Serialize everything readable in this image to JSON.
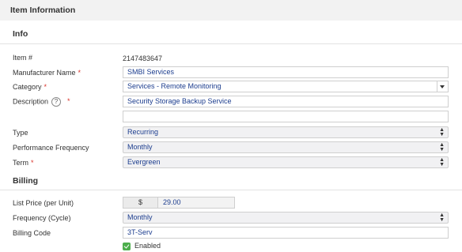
{
  "header": {
    "title": "Item Information"
  },
  "info": {
    "title": "Info",
    "item_number": {
      "label": "Item #",
      "value": "2147483647"
    },
    "manufacturer_name": {
      "label": "Manufacturer Name",
      "required_mark": "*",
      "value": "SMBI Services"
    },
    "category": {
      "label": "Category",
      "required_mark": "*",
      "value": "Services - Remote Monitoring"
    },
    "description": {
      "label": "Description",
      "help": "?",
      "required_mark": "*",
      "value": "Security Storage Backup Service",
      "extra_value": ""
    },
    "type": {
      "label": "Type",
      "value": "Recurring"
    },
    "performance_frequency": {
      "label": "Performance Frequency",
      "value": "Monthly"
    },
    "term": {
      "label": "Term",
      "required_mark": "*",
      "value": "Evergreen"
    }
  },
  "billing": {
    "title": "Billing",
    "list_price": {
      "label": "List Price (per Unit)",
      "currency": "$",
      "value": "29.00"
    },
    "frequency": {
      "label": "Frequency (Cycle)",
      "value": "Monthly"
    },
    "billing_code": {
      "label": "Billing Code",
      "value": "3T-Serv"
    },
    "enabled": {
      "label": "Enabled",
      "checked": true
    }
  },
  "colors": {
    "required": "#d9342b",
    "value_text": "#1c3d8e",
    "check": "#4cae4c"
  }
}
